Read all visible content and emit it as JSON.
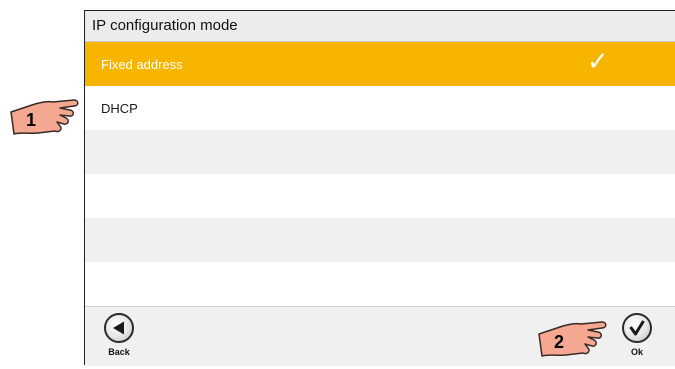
{
  "header": {
    "title": "IP configuration mode"
  },
  "options": [
    {
      "label": "Fixed address",
      "selected": true
    },
    {
      "label": "DHCP",
      "selected": false
    },
    {
      "label": "",
      "selected": false
    },
    {
      "label": "",
      "selected": false
    },
    {
      "label": "",
      "selected": false
    },
    {
      "label": "",
      "selected": false
    }
  ],
  "footer": {
    "back_label": "Back",
    "ok_label": "Ok"
  },
  "callouts": [
    {
      "number": "1"
    },
    {
      "number": "2"
    }
  ],
  "colors": {
    "selected": "#f7b500",
    "row_alt": "#f0f0f0",
    "callout": "#f4a891"
  },
  "icons": {
    "selected_check": "check-icon",
    "back": "left-arrow-icon",
    "ok": "check-circle-icon"
  }
}
